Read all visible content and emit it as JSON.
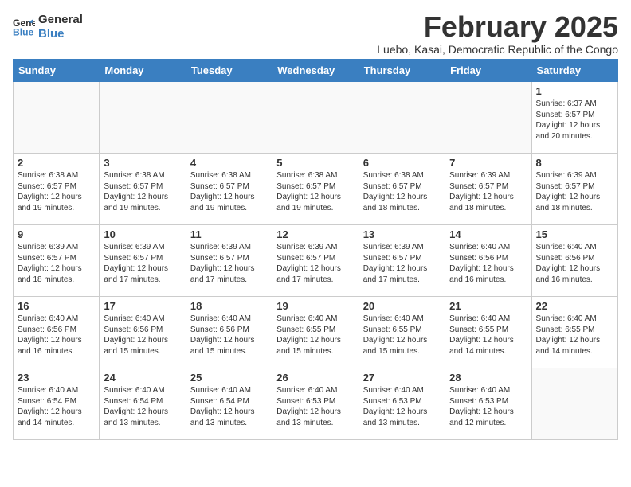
{
  "header": {
    "logo_line1": "General",
    "logo_line2": "Blue",
    "month_year": "February 2025",
    "location": "Luebo, Kasai, Democratic Republic of the Congo"
  },
  "weekdays": [
    "Sunday",
    "Monday",
    "Tuesday",
    "Wednesday",
    "Thursday",
    "Friday",
    "Saturday"
  ],
  "weeks": [
    [
      {
        "day": "",
        "text": ""
      },
      {
        "day": "",
        "text": ""
      },
      {
        "day": "",
        "text": ""
      },
      {
        "day": "",
        "text": ""
      },
      {
        "day": "",
        "text": ""
      },
      {
        "day": "",
        "text": ""
      },
      {
        "day": "1",
        "text": "Sunrise: 6:37 AM\nSunset: 6:57 PM\nDaylight: 12 hours\nand 20 minutes."
      }
    ],
    [
      {
        "day": "2",
        "text": "Sunrise: 6:38 AM\nSunset: 6:57 PM\nDaylight: 12 hours\nand 19 minutes."
      },
      {
        "day": "3",
        "text": "Sunrise: 6:38 AM\nSunset: 6:57 PM\nDaylight: 12 hours\nand 19 minutes."
      },
      {
        "day": "4",
        "text": "Sunrise: 6:38 AM\nSunset: 6:57 PM\nDaylight: 12 hours\nand 19 minutes."
      },
      {
        "day": "5",
        "text": "Sunrise: 6:38 AM\nSunset: 6:57 PM\nDaylight: 12 hours\nand 19 minutes."
      },
      {
        "day": "6",
        "text": "Sunrise: 6:38 AM\nSunset: 6:57 PM\nDaylight: 12 hours\nand 18 minutes."
      },
      {
        "day": "7",
        "text": "Sunrise: 6:39 AM\nSunset: 6:57 PM\nDaylight: 12 hours\nand 18 minutes."
      },
      {
        "day": "8",
        "text": "Sunrise: 6:39 AM\nSunset: 6:57 PM\nDaylight: 12 hours\nand 18 minutes."
      }
    ],
    [
      {
        "day": "9",
        "text": "Sunrise: 6:39 AM\nSunset: 6:57 PM\nDaylight: 12 hours\nand 18 minutes."
      },
      {
        "day": "10",
        "text": "Sunrise: 6:39 AM\nSunset: 6:57 PM\nDaylight: 12 hours\nand 17 minutes."
      },
      {
        "day": "11",
        "text": "Sunrise: 6:39 AM\nSunset: 6:57 PM\nDaylight: 12 hours\nand 17 minutes."
      },
      {
        "day": "12",
        "text": "Sunrise: 6:39 AM\nSunset: 6:57 PM\nDaylight: 12 hours\nand 17 minutes."
      },
      {
        "day": "13",
        "text": "Sunrise: 6:39 AM\nSunset: 6:57 PM\nDaylight: 12 hours\nand 17 minutes."
      },
      {
        "day": "14",
        "text": "Sunrise: 6:40 AM\nSunset: 6:56 PM\nDaylight: 12 hours\nand 16 minutes."
      },
      {
        "day": "15",
        "text": "Sunrise: 6:40 AM\nSunset: 6:56 PM\nDaylight: 12 hours\nand 16 minutes."
      }
    ],
    [
      {
        "day": "16",
        "text": "Sunrise: 6:40 AM\nSunset: 6:56 PM\nDaylight: 12 hours\nand 16 minutes."
      },
      {
        "day": "17",
        "text": "Sunrise: 6:40 AM\nSunset: 6:56 PM\nDaylight: 12 hours\nand 15 minutes."
      },
      {
        "day": "18",
        "text": "Sunrise: 6:40 AM\nSunset: 6:56 PM\nDaylight: 12 hours\nand 15 minutes."
      },
      {
        "day": "19",
        "text": "Sunrise: 6:40 AM\nSunset: 6:55 PM\nDaylight: 12 hours\nand 15 minutes."
      },
      {
        "day": "20",
        "text": "Sunrise: 6:40 AM\nSunset: 6:55 PM\nDaylight: 12 hours\nand 15 minutes."
      },
      {
        "day": "21",
        "text": "Sunrise: 6:40 AM\nSunset: 6:55 PM\nDaylight: 12 hours\nand 14 minutes."
      },
      {
        "day": "22",
        "text": "Sunrise: 6:40 AM\nSunset: 6:55 PM\nDaylight: 12 hours\nand 14 minutes."
      }
    ],
    [
      {
        "day": "23",
        "text": "Sunrise: 6:40 AM\nSunset: 6:54 PM\nDaylight: 12 hours\nand 14 minutes."
      },
      {
        "day": "24",
        "text": "Sunrise: 6:40 AM\nSunset: 6:54 PM\nDaylight: 12 hours\nand 13 minutes."
      },
      {
        "day": "25",
        "text": "Sunrise: 6:40 AM\nSunset: 6:54 PM\nDaylight: 12 hours\nand 13 minutes."
      },
      {
        "day": "26",
        "text": "Sunrise: 6:40 AM\nSunset: 6:53 PM\nDaylight: 12 hours\nand 13 minutes."
      },
      {
        "day": "27",
        "text": "Sunrise: 6:40 AM\nSunset: 6:53 PM\nDaylight: 12 hours\nand 13 minutes."
      },
      {
        "day": "28",
        "text": "Sunrise: 6:40 AM\nSunset: 6:53 PM\nDaylight: 12 hours\nand 12 minutes."
      },
      {
        "day": "",
        "text": ""
      }
    ]
  ]
}
